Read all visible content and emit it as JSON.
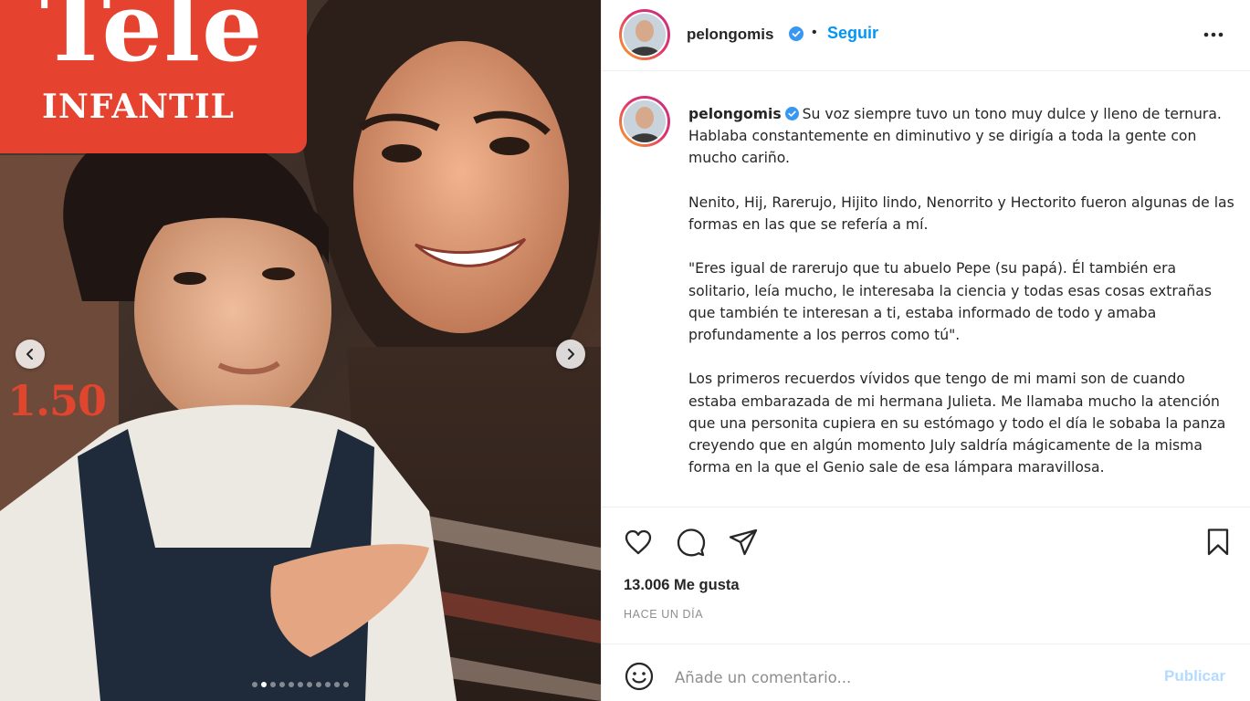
{
  "media": {
    "logo_line1": "Tele",
    "logo_line2": "INFANTIL",
    "price": "1.50",
    "slide_count": 11,
    "active_slide": 2
  },
  "header": {
    "username": "pelongomis",
    "verified": true,
    "separator": "•",
    "follow_label": "Seguir"
  },
  "caption": {
    "username": "pelongomis",
    "paragraphs": [
      "Su voz siempre tuvo un tono muy dulce y lleno de ternura. Hablaba constantemente en diminutivo y se dirigía a toda la gente con mucho cariño.",
      "Nenito, Hij, Rarerujo, Hijito lindo, Nenorrito y Hectorito fueron algunas de las formas en las que se refería a mí.",
      "\"Eres igual de rarerujo que tu abuelo Pepe (su papá). Él también era solitario, leía mucho, le interesaba la ciencia y todas esas cosas extrañas que también te interesan a ti, estaba informado de todo y amaba profundamente a los perros como tú\".",
      "Los primeros recuerdos vívidos que tengo de mi mami son de cuando estaba embarazada de mi hermana Julieta. Me llamaba mucho la atención que una personita cupiera en su estómago y todo el día le sobaba la panza creyendo que en algún momento July saldría mágicamente de la misma forma en la que el Genio sale de esa lámpara maravillosa."
    ]
  },
  "actions": {
    "likes": "13.006 Me gusta",
    "timestamp": "HACE UN DÍA"
  },
  "comment": {
    "placeholder": "Añade un comentario...",
    "publish_label": "Publicar"
  },
  "colors": {
    "accent": "#0095f6",
    "publish_disabled": "#b3dbff",
    "muted": "#8e8e8e",
    "magazine_red": "#e5432f"
  }
}
